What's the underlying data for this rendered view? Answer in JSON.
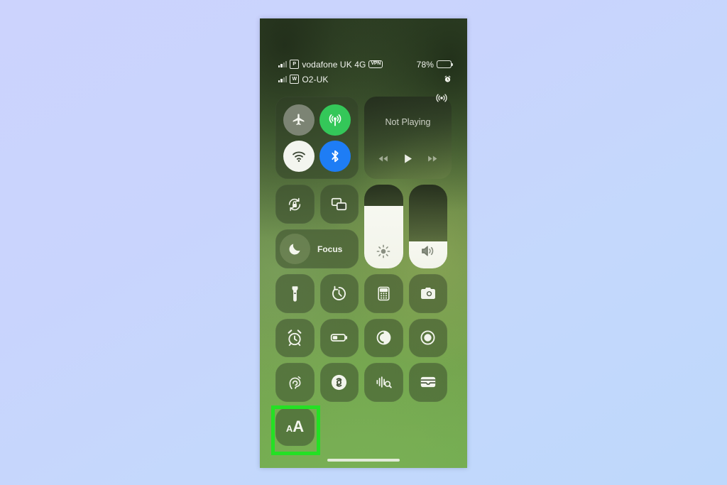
{
  "page": {
    "background_color": "#c9d3fd",
    "description": "iOS Control Center screenshot with green highlight around text size button"
  },
  "phone": {
    "wallpaper_color": "#6d9049",
    "status_bar": {
      "carriers": [
        {
          "sim_badge": "P",
          "name": "vodafone UK 4G",
          "vpn_badge": "VPN"
        },
        {
          "sim_badge": "W",
          "name": "O2-UK",
          "vpn_badge": ""
        }
      ],
      "battery_percent": "78%",
      "battery_level": 78,
      "alarm_icon": "alarm-clock-icon"
    },
    "control_center": {
      "connectivity": {
        "buttons": [
          {
            "name": "airplane-mode",
            "icon": "airplane-icon",
            "state": "off",
            "color": "#7c8474"
          },
          {
            "name": "cellular-data",
            "icon": "cellular-antenna-icon",
            "state": "on",
            "color": "#34c759"
          },
          {
            "name": "wifi",
            "icon": "wifi-icon",
            "state": "on",
            "color": "#f3f5ef"
          },
          {
            "name": "bluetooth",
            "icon": "bluetooth-icon",
            "state": "on",
            "color": "#1e7df5"
          }
        ]
      },
      "now_playing": {
        "title": "Not Playing",
        "airplay_icon": "airplay-audio-icon",
        "controls": [
          {
            "name": "rewind-button",
            "icon": "rewind-icon"
          },
          {
            "name": "play-button",
            "icon": "play-icon"
          },
          {
            "name": "fast-forward-button",
            "icon": "fast-forward-icon"
          }
        ]
      },
      "rotation_lock": {
        "label": "",
        "icon": "rotation-lock-icon"
      },
      "screen_mirroring": {
        "label": "",
        "icon": "screen-mirroring-icon"
      },
      "focus": {
        "label": "Focus",
        "icon": "moon-icon"
      },
      "brightness": {
        "name": "brightness-slider",
        "icon": "brightness-sun-icon",
        "value": 75
      },
      "volume": {
        "name": "volume-slider",
        "icon": "volume-speaker-icon",
        "value": 32
      },
      "tiles": [
        [
          {
            "name": "flashlight",
            "icon": "flashlight-icon"
          },
          {
            "name": "timer",
            "icon": "timer-icon"
          },
          {
            "name": "calculator",
            "icon": "calculator-icon"
          },
          {
            "name": "camera",
            "icon": "camera-icon"
          }
        ],
        [
          {
            "name": "alarm",
            "icon": "alarm-clock-icon"
          },
          {
            "name": "low-power-mode",
            "icon": "battery-icon"
          },
          {
            "name": "dark-mode",
            "icon": "dark-mode-icon"
          },
          {
            "name": "screen-recording",
            "icon": "record-icon"
          }
        ],
        [
          {
            "name": "hearing",
            "icon": "ear-icon"
          },
          {
            "name": "shazam",
            "icon": "shazam-icon"
          },
          {
            "name": "sound-recognition",
            "icon": "sound-recognition-icon"
          },
          {
            "name": "wallet",
            "icon": "wallet-icon"
          }
        ],
        [
          {
            "name": "text-size",
            "icon": "text-size-icon",
            "label_small": "A",
            "label_big": "A",
            "highlighted": true
          }
        ]
      ]
    },
    "home_indicator": "home-indicator"
  },
  "highlight": {
    "color": "#24e024",
    "target": "text-size-button"
  }
}
